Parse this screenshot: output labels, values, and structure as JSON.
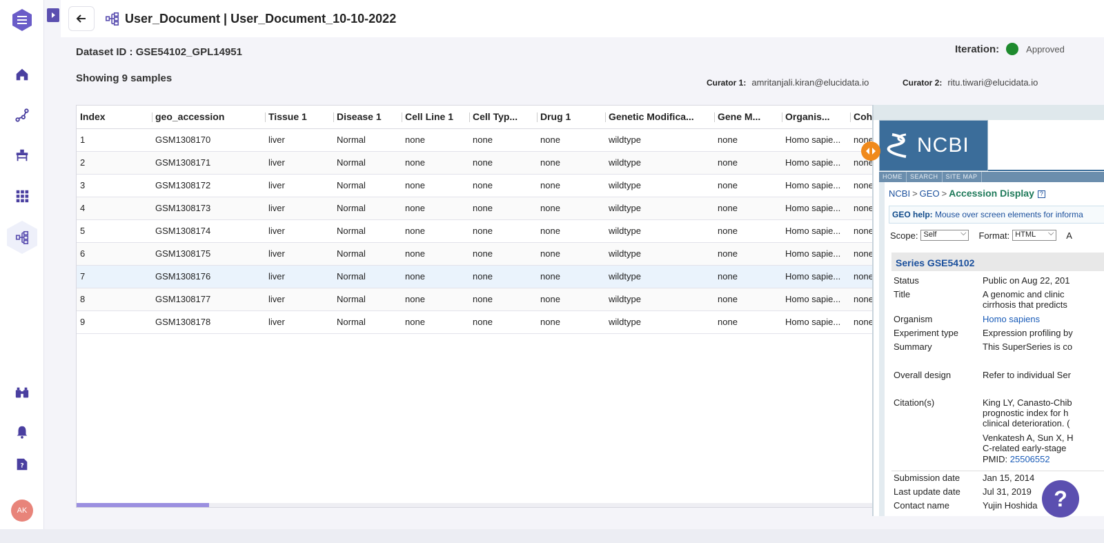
{
  "header": {
    "title": "User_Document | User_Document_10-10-2022",
    "back_icon": "arrow-left-icon",
    "dataset_icon": "dataset-tree-icon"
  },
  "dataset": {
    "id_label": "Dataset ID : GSE54102_GPL14951",
    "showing": "Showing 9 samples"
  },
  "iteration": {
    "label": "Iteration:",
    "status": "Approved",
    "status_color": "#1e8a2e"
  },
  "curators": [
    {
      "label": "Curator 1:",
      "email": "amritanjali.kiran@elucidata.io"
    },
    {
      "label": "Curator 2:",
      "email": "ritu.tiwari@elucidata.io"
    }
  ],
  "sidebar": {
    "items": [
      "home-icon",
      "graph-icon",
      "workbench-icon",
      "apps-grid-icon",
      "dataset-icon",
      "binoculars-icon",
      "bell-icon",
      "help-doc-icon"
    ],
    "avatar": "AK"
  },
  "table": {
    "columns": [
      "Index",
      "geo_accession",
      "Tissue 1",
      "Disease 1",
      "Cell Line 1",
      "Cell Typ...",
      "Drug 1",
      "Genetic Modifica...",
      "Gene M...",
      "Organis...",
      "Coh"
    ],
    "rows": [
      [
        "1",
        "GSM1308170",
        "liver",
        "Normal",
        "none",
        "none",
        "none",
        "wildtype",
        "none",
        "Homo sapie...",
        "none"
      ],
      [
        "2",
        "GSM1308171",
        "liver",
        "Normal",
        "none",
        "none",
        "none",
        "wildtype",
        "none",
        "Homo sapie...",
        "none"
      ],
      [
        "3",
        "GSM1308172",
        "liver",
        "Normal",
        "none",
        "none",
        "none",
        "wildtype",
        "none",
        "Homo sapie...",
        "none"
      ],
      [
        "4",
        "GSM1308173",
        "liver",
        "Normal",
        "none",
        "none",
        "none",
        "wildtype",
        "none",
        "Homo sapie...",
        "none"
      ],
      [
        "5",
        "GSM1308174",
        "liver",
        "Normal",
        "none",
        "none",
        "none",
        "wildtype",
        "none",
        "Homo sapie...",
        "none"
      ],
      [
        "6",
        "GSM1308175",
        "liver",
        "Normal",
        "none",
        "none",
        "none",
        "wildtype",
        "none",
        "Homo sapie...",
        "none"
      ],
      [
        "7",
        "GSM1308176",
        "liver",
        "Normal",
        "none",
        "none",
        "none",
        "wildtype",
        "none",
        "Homo sapie...",
        "none"
      ],
      [
        "8",
        "GSM1308177",
        "liver",
        "Normal",
        "none",
        "none",
        "none",
        "wildtype",
        "none",
        "Homo sapie...",
        "none"
      ],
      [
        "9",
        "GSM1308178",
        "liver",
        "Normal",
        "none",
        "none",
        "none",
        "wildtype",
        "none",
        "Homo sapie...",
        "none"
      ]
    ],
    "highlighted_row": 7
  },
  "ncbi": {
    "logo_text": "NCBI",
    "menu": [
      "HOME",
      "SEARCH",
      "SITE MAP"
    ],
    "crumb_1": "NCBI",
    "crumb_2": "GEO",
    "crumb_3": "Accession Display",
    "help_label": "GEO help:",
    "help_text": "Mouse over screen elements for informa",
    "scope_label": "Scope:",
    "scope_value": "Self",
    "format_label": "Format:",
    "format_value": "HTML",
    "amount_label": "A",
    "series": "Series GSE54102",
    "fields": {
      "status_k": "Status",
      "status_v": "Public on Aug 22, 201",
      "title_k": "Title",
      "title_v1": "A genomic and clinic",
      "title_v2": "cirrhosis that predicts",
      "organism_k": "Organism",
      "organism_v": "Homo sapiens",
      "exp_k": "Experiment type",
      "exp_v": "Expression profiling by",
      "summary_k": "Summary",
      "summary_v": "This SuperSeries is co",
      "design_k": "Overall design",
      "design_v": "Refer to individual Ser",
      "citation_k": "Citation(s)",
      "cit_1": "King LY, Canasto-Chib",
      "cit_2": "prognostic index for h",
      "cit_3": "clinical deterioration. (",
      "cit_4": "Venkatesh A, Sun X, H",
      "cit_5": "C-related early-stage",
      "pmid_label": "PMID:",
      "pmid": "25506552",
      "sub_k": "Submission date",
      "sub_v": "Jan 15, 2014",
      "upd_k": "Last update date",
      "upd_v": "Jul 31, 2019",
      "contact_k": "Contact name",
      "contact_v": "Yujin Hoshida"
    }
  },
  "help_fab": "?"
}
